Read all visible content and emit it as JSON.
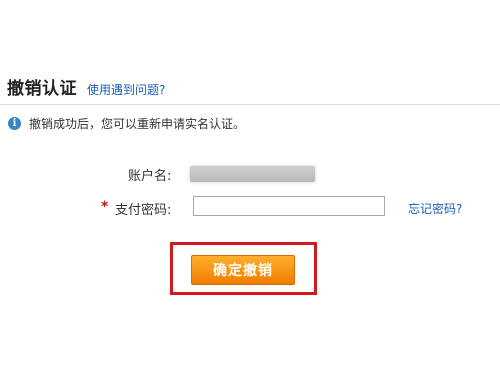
{
  "header": {
    "title": "撤销认证",
    "help_link": "使用遇到问题?"
  },
  "info": {
    "icon": "info-icon",
    "text": "撤销成功后，您可以重新申请实名认证。"
  },
  "form": {
    "account_label": "账户名:",
    "required_mark": "*",
    "password_label": "支付密码:",
    "password_value": "",
    "forgot_link": "忘记密码?"
  },
  "action": {
    "confirm_label": "确定撤销"
  },
  "colors": {
    "link": "#1a5fb4",
    "button": "#f59a1a",
    "highlight_box": "#d31920",
    "required": "#c0171e"
  }
}
